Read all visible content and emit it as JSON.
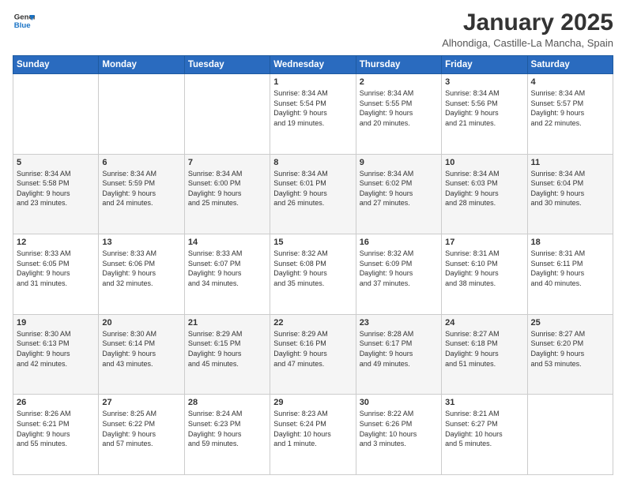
{
  "logo": {
    "line1": "General",
    "line2": "Blue"
  },
  "header": {
    "title": "January 2025",
    "subtitle": "Alhondiga, Castille-La Mancha, Spain"
  },
  "days_of_week": [
    "Sunday",
    "Monday",
    "Tuesday",
    "Wednesday",
    "Thursday",
    "Friday",
    "Saturday"
  ],
  "weeks": [
    [
      {
        "day": "",
        "info": ""
      },
      {
        "day": "",
        "info": ""
      },
      {
        "day": "",
        "info": ""
      },
      {
        "day": "1",
        "info": "Sunrise: 8:34 AM\nSunset: 5:54 PM\nDaylight: 9 hours\nand 19 minutes."
      },
      {
        "day": "2",
        "info": "Sunrise: 8:34 AM\nSunset: 5:55 PM\nDaylight: 9 hours\nand 20 minutes."
      },
      {
        "day": "3",
        "info": "Sunrise: 8:34 AM\nSunset: 5:56 PM\nDaylight: 9 hours\nand 21 minutes."
      },
      {
        "day": "4",
        "info": "Sunrise: 8:34 AM\nSunset: 5:57 PM\nDaylight: 9 hours\nand 22 minutes."
      }
    ],
    [
      {
        "day": "5",
        "info": "Sunrise: 8:34 AM\nSunset: 5:58 PM\nDaylight: 9 hours\nand 23 minutes."
      },
      {
        "day": "6",
        "info": "Sunrise: 8:34 AM\nSunset: 5:59 PM\nDaylight: 9 hours\nand 24 minutes."
      },
      {
        "day": "7",
        "info": "Sunrise: 8:34 AM\nSunset: 6:00 PM\nDaylight: 9 hours\nand 25 minutes."
      },
      {
        "day": "8",
        "info": "Sunrise: 8:34 AM\nSunset: 6:01 PM\nDaylight: 9 hours\nand 26 minutes."
      },
      {
        "day": "9",
        "info": "Sunrise: 8:34 AM\nSunset: 6:02 PM\nDaylight: 9 hours\nand 27 minutes."
      },
      {
        "day": "10",
        "info": "Sunrise: 8:34 AM\nSunset: 6:03 PM\nDaylight: 9 hours\nand 28 minutes."
      },
      {
        "day": "11",
        "info": "Sunrise: 8:34 AM\nSunset: 6:04 PM\nDaylight: 9 hours\nand 30 minutes."
      }
    ],
    [
      {
        "day": "12",
        "info": "Sunrise: 8:33 AM\nSunset: 6:05 PM\nDaylight: 9 hours\nand 31 minutes."
      },
      {
        "day": "13",
        "info": "Sunrise: 8:33 AM\nSunset: 6:06 PM\nDaylight: 9 hours\nand 32 minutes."
      },
      {
        "day": "14",
        "info": "Sunrise: 8:33 AM\nSunset: 6:07 PM\nDaylight: 9 hours\nand 34 minutes."
      },
      {
        "day": "15",
        "info": "Sunrise: 8:32 AM\nSunset: 6:08 PM\nDaylight: 9 hours\nand 35 minutes."
      },
      {
        "day": "16",
        "info": "Sunrise: 8:32 AM\nSunset: 6:09 PM\nDaylight: 9 hours\nand 37 minutes."
      },
      {
        "day": "17",
        "info": "Sunrise: 8:31 AM\nSunset: 6:10 PM\nDaylight: 9 hours\nand 38 minutes."
      },
      {
        "day": "18",
        "info": "Sunrise: 8:31 AM\nSunset: 6:11 PM\nDaylight: 9 hours\nand 40 minutes."
      }
    ],
    [
      {
        "day": "19",
        "info": "Sunrise: 8:30 AM\nSunset: 6:13 PM\nDaylight: 9 hours\nand 42 minutes."
      },
      {
        "day": "20",
        "info": "Sunrise: 8:30 AM\nSunset: 6:14 PM\nDaylight: 9 hours\nand 43 minutes."
      },
      {
        "day": "21",
        "info": "Sunrise: 8:29 AM\nSunset: 6:15 PM\nDaylight: 9 hours\nand 45 minutes."
      },
      {
        "day": "22",
        "info": "Sunrise: 8:29 AM\nSunset: 6:16 PM\nDaylight: 9 hours\nand 47 minutes."
      },
      {
        "day": "23",
        "info": "Sunrise: 8:28 AM\nSunset: 6:17 PM\nDaylight: 9 hours\nand 49 minutes."
      },
      {
        "day": "24",
        "info": "Sunrise: 8:27 AM\nSunset: 6:18 PM\nDaylight: 9 hours\nand 51 minutes."
      },
      {
        "day": "25",
        "info": "Sunrise: 8:27 AM\nSunset: 6:20 PM\nDaylight: 9 hours\nand 53 minutes."
      }
    ],
    [
      {
        "day": "26",
        "info": "Sunrise: 8:26 AM\nSunset: 6:21 PM\nDaylight: 9 hours\nand 55 minutes."
      },
      {
        "day": "27",
        "info": "Sunrise: 8:25 AM\nSunset: 6:22 PM\nDaylight: 9 hours\nand 57 minutes."
      },
      {
        "day": "28",
        "info": "Sunrise: 8:24 AM\nSunset: 6:23 PM\nDaylight: 9 hours\nand 59 minutes."
      },
      {
        "day": "29",
        "info": "Sunrise: 8:23 AM\nSunset: 6:24 PM\nDaylight: 10 hours\nand 1 minute."
      },
      {
        "day": "30",
        "info": "Sunrise: 8:22 AM\nSunset: 6:26 PM\nDaylight: 10 hours\nand 3 minutes."
      },
      {
        "day": "31",
        "info": "Sunrise: 8:21 AM\nSunset: 6:27 PM\nDaylight: 10 hours\nand 5 minutes."
      },
      {
        "day": "",
        "info": ""
      }
    ]
  ]
}
